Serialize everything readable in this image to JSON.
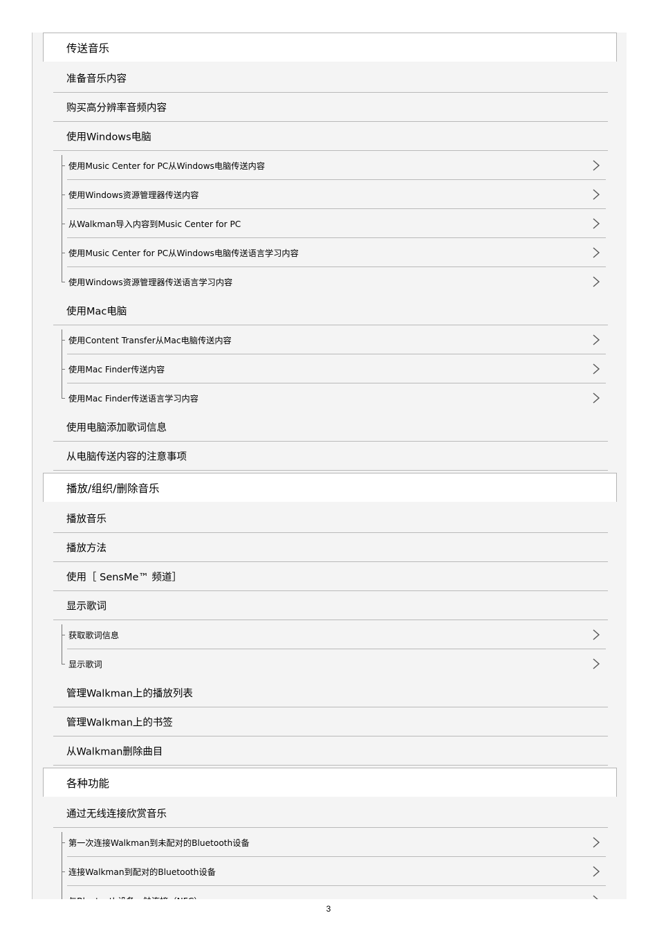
{
  "sections": [
    {
      "title": "传送音乐",
      "items": [
        {
          "label": "准备音乐内容",
          "children": []
        },
        {
          "label": "购买高分辨率音频内容",
          "children": []
        },
        {
          "label": "使用Windows电脑",
          "children": [
            "使用Music Center for PC从Windows电脑传送内容",
            "使用Windows资源管理器传送内容",
            "从Walkman导入内容到Music Center for PC",
            "使用Music Center for PC从Windows电脑传送语言学习内容",
            "使用Windows资源管理器传送语言学习内容"
          ]
        },
        {
          "label": "使用Mac电脑",
          "children": [
            "使用Content Transfer从Mac电脑传送内容",
            "使用Mac Finder传送内容",
            "使用Mac Finder传送语言学习内容"
          ]
        },
        {
          "label": "使用电脑添加歌词信息",
          "children": []
        },
        {
          "label": "从电脑传送内容的注意事项",
          "children": []
        }
      ]
    },
    {
      "title": "播放/组织/删除音乐",
      "items": [
        {
          "label": "播放音乐",
          "children": []
        },
        {
          "label": "播放方法",
          "children": []
        },
        {
          "label": "使用［ SensMe™ 频道］",
          "children": []
        },
        {
          "label": "显示歌词",
          "children": [
            "获取歌词信息",
            "显示歌词"
          ]
        },
        {
          "label": "管理Walkman上的播放列表",
          "children": []
        },
        {
          "label": "管理Walkman上的书签",
          "children": []
        },
        {
          "label": "从Walkman删除曲目",
          "children": []
        }
      ]
    },
    {
      "title": "各种功能",
      "items": [
        {
          "label": "通过无线连接欣赏音乐",
          "children": [
            "第一次连接Walkman到未配对的Bluetooth设备",
            "连接Walkman到配对的Bluetooth设备",
            "与Bluetooth设备一触连接（NFC）"
          ]
        }
      ]
    }
  ],
  "icons": {
    "row_arrow": "chevron-right-icon"
  },
  "page_number": "3"
}
